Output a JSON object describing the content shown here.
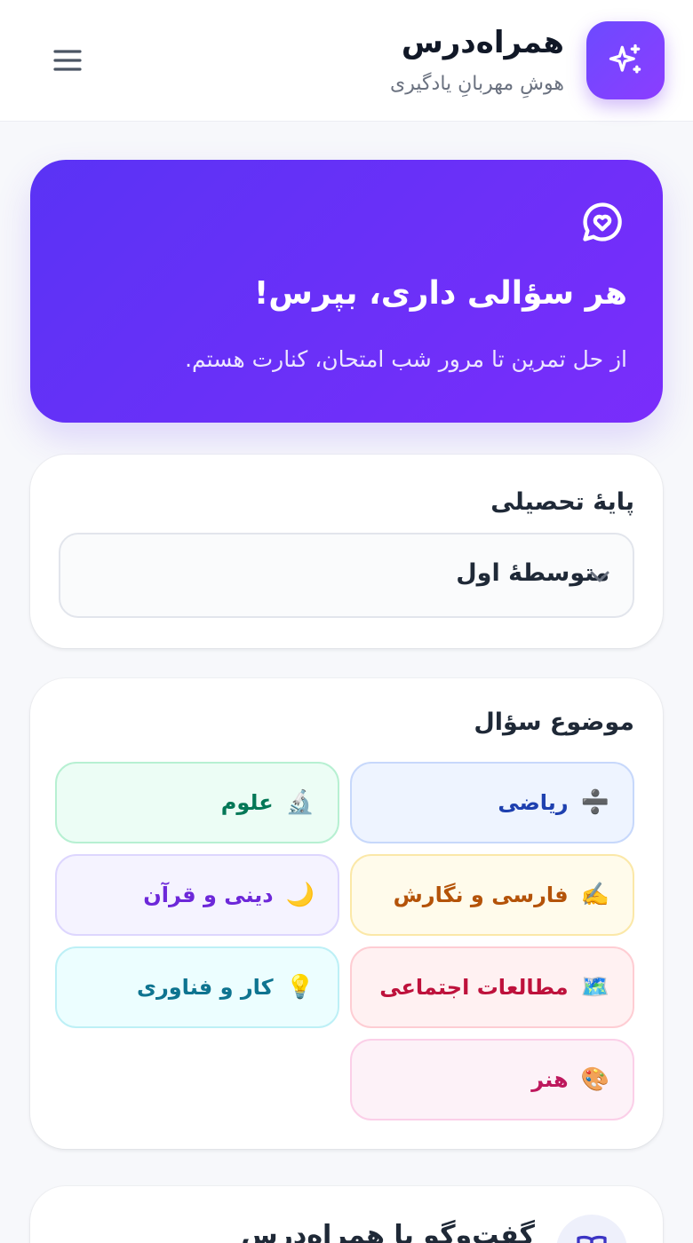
{
  "header": {
    "title": "همراه‌درس",
    "subtitle": "هوشِ مهربانِ یادگیری",
    "logo_icon": "sparkles-icon",
    "menu_icon": "hamburger-menu-icon"
  },
  "hero": {
    "icon": "chat-heart-icon",
    "title": "هر سؤالی داری، بپرس!",
    "text": "از حل تمرین تا مرور شب امتحان، کنارت هستم."
  },
  "grade": {
    "label": "پایهٔ تحصیلی",
    "selected": "متوسطهٔ اول"
  },
  "subjects": {
    "label": "موضوع سؤال",
    "items": [
      {
        "emoji": "➗",
        "label": "ریاضی",
        "bg": "#eef4ff",
        "border": "#c7d8fb",
        "color": "#1e40af"
      },
      {
        "emoji": "🔬",
        "label": "علوم",
        "bg": "#ecfdf5",
        "border": "#b7f0d2",
        "color": "#047857"
      },
      {
        "emoji": "✍️",
        "label": "فارسی و نگارش",
        "bg": "#fffbeb",
        "border": "#fbe8a8",
        "color": "#b45309"
      },
      {
        "emoji": "🌙",
        "label": "دینی و قرآن",
        "bg": "#f5f3ff",
        "border": "#ddd6fe",
        "color": "#6d28d9"
      },
      {
        "emoji": "🗺️",
        "label": "مطالعات اجتماعی",
        "bg": "#fff1f2",
        "border": "#fecdd3",
        "color": "#be123c"
      },
      {
        "emoji": "💡",
        "label": "کار و فناوری",
        "bg": "#ecfeff",
        "border": "#bdf0f6",
        "color": "#0e7490"
      },
      {
        "emoji": "🎨",
        "label": "هنر",
        "bg": "#fdf2f8",
        "border": "#fbcfe8",
        "color": "#be185d"
      }
    ]
  },
  "chat": {
    "title": "گفت‌وگو با همراه‌درس",
    "icon": "book-open-icon"
  }
}
